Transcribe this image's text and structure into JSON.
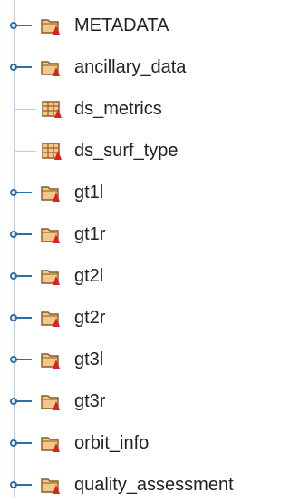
{
  "tree": {
    "items": [
      {
        "label": "METADATA",
        "type": "group",
        "icon": "group-folder-icon",
        "expandable": true
      },
      {
        "label": "ancillary_data",
        "type": "group",
        "icon": "group-folder-icon",
        "expandable": true
      },
      {
        "label": "ds_metrics",
        "type": "dataset",
        "icon": "dataset-table-icon",
        "expandable": false
      },
      {
        "label": "ds_surf_type",
        "type": "dataset",
        "icon": "dataset-table-icon",
        "expandable": false
      },
      {
        "label": "gt1l",
        "type": "group",
        "icon": "group-folder-icon",
        "expandable": true
      },
      {
        "label": "gt1r",
        "type": "group",
        "icon": "group-folder-icon",
        "expandable": true
      },
      {
        "label": "gt2l",
        "type": "group",
        "icon": "group-folder-icon",
        "expandable": true
      },
      {
        "label": "gt2r",
        "type": "group",
        "icon": "group-folder-icon",
        "expandable": true
      },
      {
        "label": "gt3l",
        "type": "group",
        "icon": "group-folder-icon",
        "expandable": true
      },
      {
        "label": "gt3r",
        "type": "group",
        "icon": "group-folder-icon",
        "expandable": true
      },
      {
        "label": "orbit_info",
        "type": "group",
        "icon": "group-folder-icon",
        "expandable": true
      },
      {
        "label": "quality_assessment",
        "type": "group",
        "icon": "group-folder-icon",
        "expandable": true
      }
    ]
  },
  "colors": {
    "tree_line": "#b8cfe2",
    "handle": "#2f6ea5",
    "folder_fill": "#f3c98b",
    "folder_stroke": "#8a5a1f",
    "attribute_badge": "#e02020",
    "table_grid": "#9a5a2a",
    "text": "#222222"
  }
}
